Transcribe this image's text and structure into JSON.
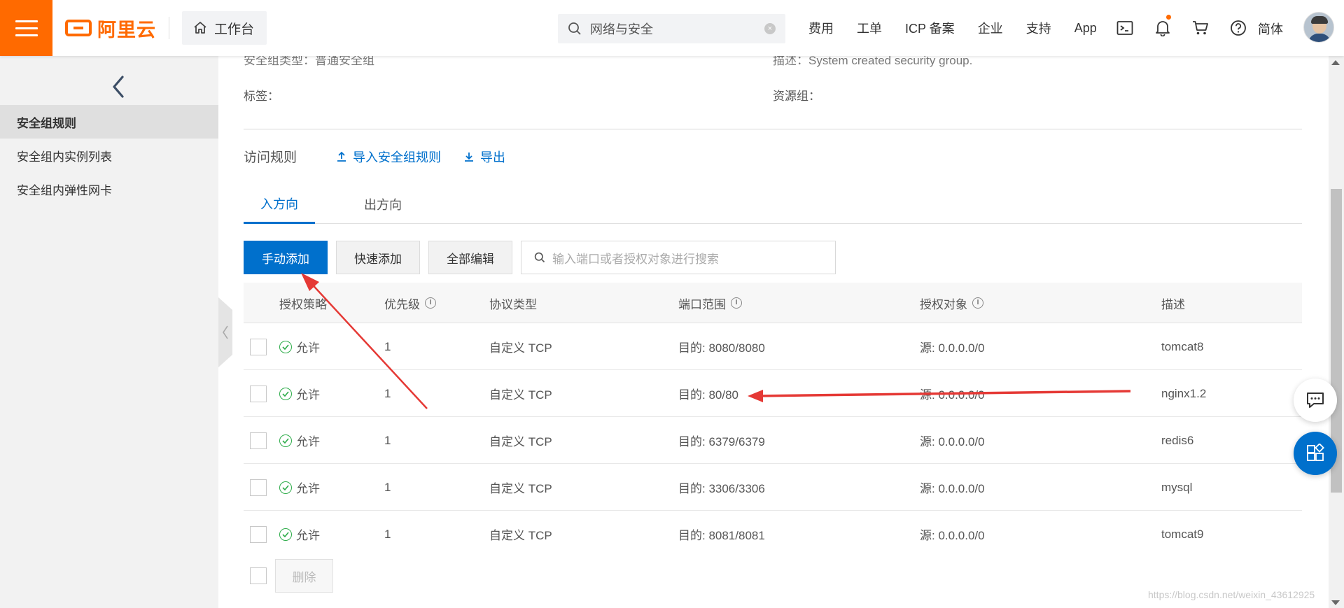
{
  "header": {
    "logo_text": "阿里云",
    "workbench_label": "工作台",
    "search_value": "网络与安全",
    "nav_items": [
      "费用",
      "工单",
      "ICP 备案",
      "企业",
      "支持",
      "App"
    ],
    "lang": "简体",
    "brand_color": "#ff6a00"
  },
  "sidebar": {
    "items": [
      {
        "label": "安全组规则",
        "active": true
      },
      {
        "label": "安全组内实例列表",
        "active": false
      },
      {
        "label": "安全组内弹性网卡",
        "active": false
      }
    ]
  },
  "info": {
    "type_label": "安全组类型：",
    "type_value": "普通安全组",
    "desc_label": "描述：",
    "desc_value": "System created security group.",
    "tags_label": "标签：",
    "resource_group_label": "资源组："
  },
  "rules": {
    "title": "访问规则",
    "import_label": "导入安全组规则",
    "export_label": "导出",
    "tabs": [
      "入方向",
      "出方向"
    ],
    "manual_add": "手动添加",
    "quick_add": "快速添加",
    "edit_all": "全部编辑",
    "search_placeholder": "输入端口或者授权对象进行搜索",
    "delete_label": "删除",
    "accent_color": "#0070cc"
  },
  "table": {
    "headers": [
      "授权策略",
      "优先级",
      "协议类型",
      "端口范围",
      "授权对象",
      "描述"
    ],
    "rows": [
      {
        "policy": "允许",
        "priority": "1",
        "protocol": "自定义 TCP",
        "port": "目的: 8080/8080",
        "source": "源: 0.0.0.0/0",
        "desc": "tomcat8"
      },
      {
        "policy": "允许",
        "priority": "1",
        "protocol": "自定义 TCP",
        "port": "目的: 80/80",
        "source": "源: 0.0.0.0/0",
        "desc": "nginx1.2"
      },
      {
        "policy": "允许",
        "priority": "1",
        "protocol": "自定义 TCP",
        "port": "目的: 6379/6379",
        "source": "源: 0.0.0.0/0",
        "desc": "redis6"
      },
      {
        "policy": "允许",
        "priority": "1",
        "protocol": "自定义 TCP",
        "port": "目的: 3306/3306",
        "source": "源: 0.0.0.0/0",
        "desc": "mysql"
      },
      {
        "policy": "允许",
        "priority": "1",
        "protocol": "自定义 TCP",
        "port": "目的: 8081/8081",
        "source": "源: 0.0.0.0/0",
        "desc": "tomcat9"
      }
    ]
  },
  "watermark": "https://blog.csdn.net/weixin_43612925"
}
